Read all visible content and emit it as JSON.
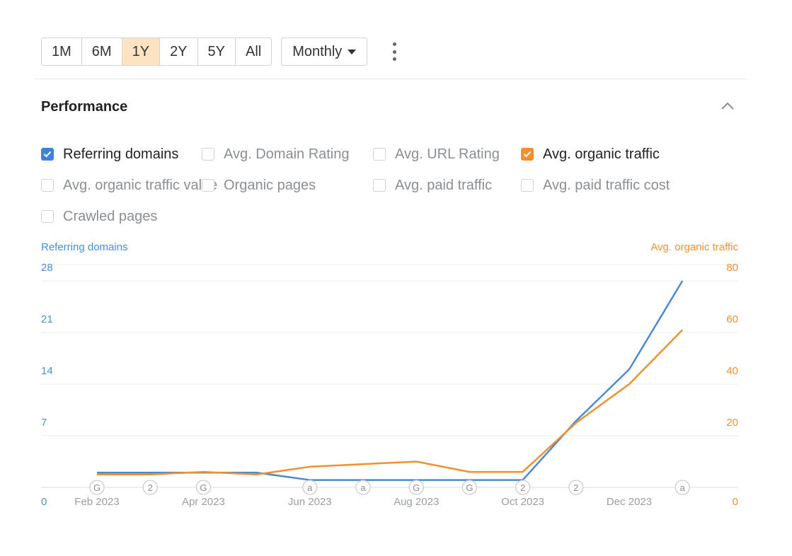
{
  "toolbar": {
    "ranges": [
      {
        "label": "1M",
        "active": false
      },
      {
        "label": "6M",
        "active": false
      },
      {
        "label": "1Y",
        "active": true
      },
      {
        "label": "2Y",
        "active": false
      },
      {
        "label": "5Y",
        "active": false
      },
      {
        "label": "All",
        "active": false
      }
    ],
    "interval": "Monthly"
  },
  "section": {
    "title": "Performance"
  },
  "metrics": [
    [
      {
        "label": "Referring domains",
        "checked": true,
        "color": "#3d83da"
      },
      {
        "label": "Avg. Domain Rating",
        "checked": false
      },
      {
        "label": "Avg. URL Rating",
        "checked": false
      },
      {
        "label": "Avg. organic traffic",
        "checked": true,
        "color": "#f0902e"
      }
    ],
    [
      {
        "label": "Avg. organic traffic value",
        "checked": false
      },
      {
        "label": "Organic pages",
        "checked": false
      },
      {
        "label": "Avg. paid traffic",
        "checked": false
      },
      {
        "label": "Avg. paid traffic cost",
        "checked": false
      }
    ],
    [
      {
        "label": "Crawled pages",
        "checked": false
      }
    ]
  ],
  "chart_data": {
    "type": "line",
    "left_axis": {
      "title": "Referring domains",
      "ticks": [
        0,
        7,
        14,
        21,
        28
      ],
      "max": 28,
      "color": "#4a8fd6"
    },
    "right_axis": {
      "title": "Avg. organic traffic",
      "ticks": [
        0,
        20,
        40,
        60,
        80
      ],
      "max": 80,
      "color": "#f0902e"
    },
    "x_labels": [
      "Feb 2023",
      "Apr 2023",
      "Jun 2023",
      "Aug 2023",
      "Oct 2023",
      "Dec 2023"
    ],
    "x_label_index": [
      0,
      2,
      4,
      6,
      8,
      10
    ],
    "n_points": 12,
    "series": [
      {
        "name": "Referring domains",
        "axis": "left",
        "color": "#4a8ad4",
        "values": [
          2,
          2,
          2,
          2,
          1,
          1,
          1,
          1,
          1,
          9,
          16,
          28
        ]
      },
      {
        "name": "Avg. organic traffic",
        "axis": "right",
        "color": "#f0902e",
        "values": [
          5,
          5,
          6,
          5,
          8,
          9,
          10,
          6,
          6,
          25,
          40,
          61
        ]
      }
    ],
    "annotations": [
      {
        "index": 0,
        "label": "G"
      },
      {
        "index": 1,
        "label": "2"
      },
      {
        "index": 2,
        "label": "G"
      },
      {
        "index": 4,
        "label": "a"
      },
      {
        "index": 5,
        "label": "a"
      },
      {
        "index": 6,
        "label": "G"
      },
      {
        "index": 7,
        "label": "G"
      },
      {
        "index": 8,
        "label": "2"
      },
      {
        "index": 9,
        "label": "2"
      },
      {
        "index": 11,
        "label": "a"
      }
    ]
  }
}
